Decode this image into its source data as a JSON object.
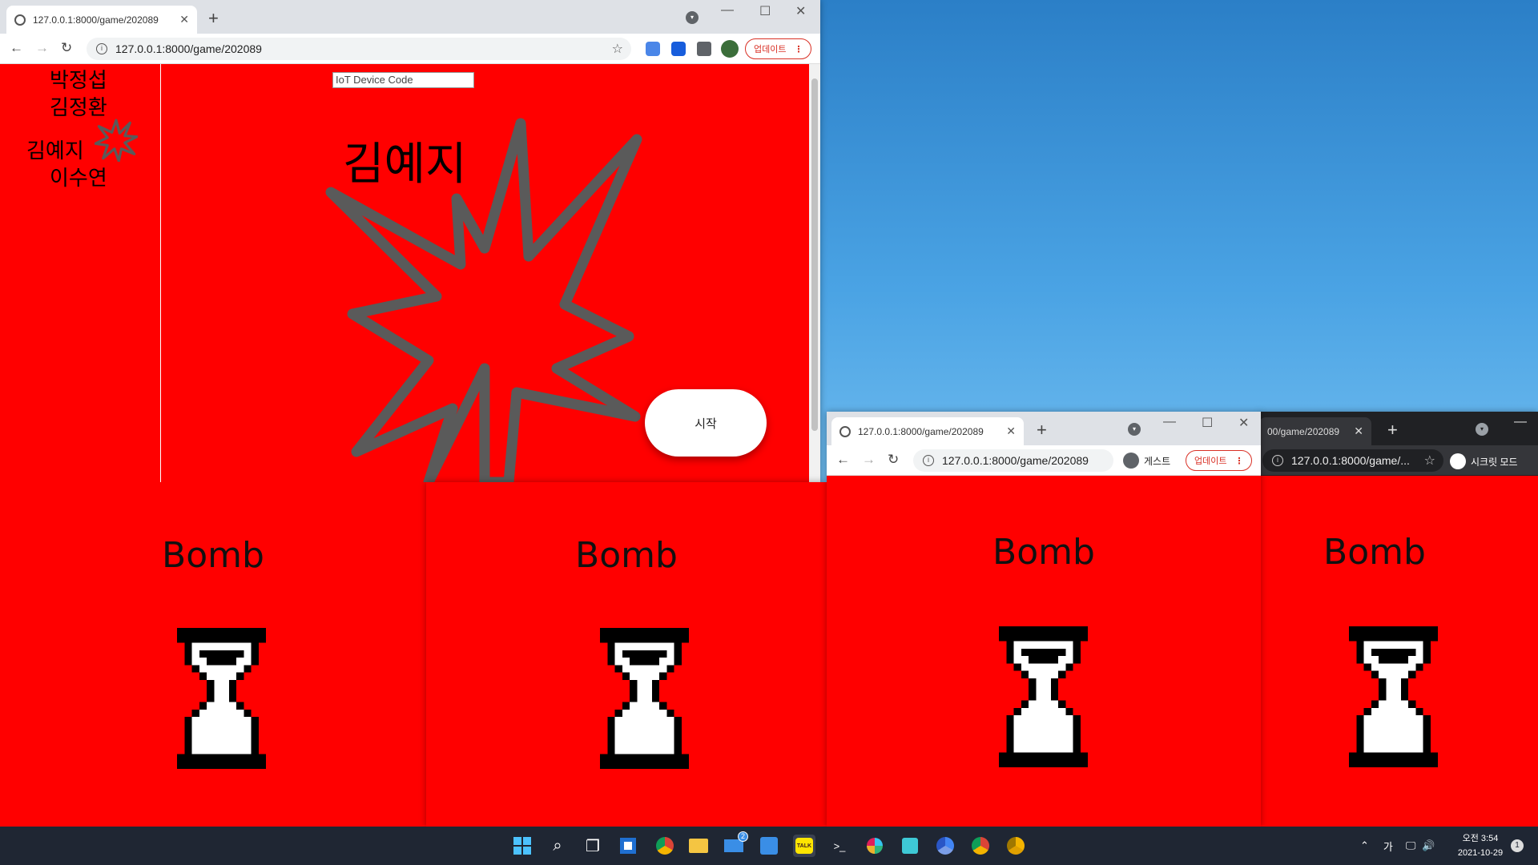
{
  "main_window": {
    "tab_title": "127.0.0.1:8000/game/202089",
    "url": "127.0.0.1:8000/game/202089",
    "update_label": "업데이트",
    "players": [
      "박정섭",
      "김정환",
      "김예지",
      "이수연"
    ],
    "device_code_placeholder": "IoT Device Code",
    "current_player": "김예지",
    "start_label": "시작",
    "background": "#ff0000",
    "burst_color": "#5a5a5a"
  },
  "bomb_panels": [
    {
      "title": "Bomb"
    },
    {
      "title": "Bomb"
    },
    {
      "title": "Bomb"
    },
    {
      "title": "Bomb"
    }
  ],
  "guest_window": {
    "tab_title": "127.0.0.1:8000/game/202089",
    "url": "127.0.0.1:8000/game/202089",
    "profile_label": "게스트",
    "update_label": "업데이트"
  },
  "incognito_window": {
    "tab_title": "00/game/202089",
    "url": "127.0.0.1:8000/game/...",
    "profile_label": "시크릿 모드"
  },
  "taskbar": {
    "icons": [
      "windows-start-icon",
      "search-icon",
      "task-view-icon",
      "widgets-icon",
      "chrome-icon",
      "file-explorer-icon",
      "mail-icon",
      "calendar-icon",
      "kakaotalk-icon",
      "terminal-icon",
      "slack-icon",
      "vscode-icon",
      "chrome-dev-icon",
      "chrome-icon",
      "chrome-canary-icon"
    ],
    "mail_badge": "2",
    "kakao_label": "TALK",
    "ime": "가",
    "time": "오전 3:54",
    "date": "2021-10-29",
    "notification_count": "1"
  }
}
